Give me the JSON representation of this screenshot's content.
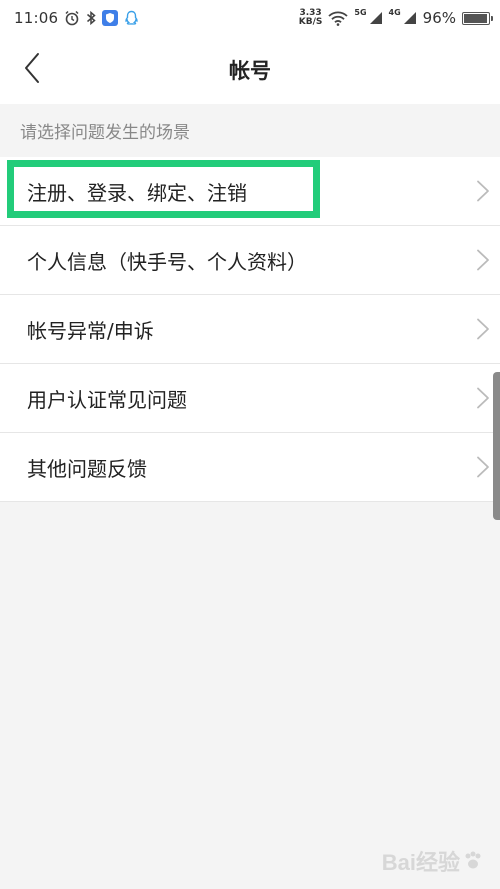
{
  "status_bar": {
    "time": "11:06",
    "net_speed_value": "3.33",
    "net_speed_unit": "KB/S",
    "signal_label_1": "5G",
    "signal_label_2": "4G",
    "battery_percent": "96%",
    "battery_level": 0.96,
    "icons": [
      "alarm-icon",
      "bluetooth-icon",
      "shield-app-icon",
      "qq-icon",
      "wifi-icon",
      "signal-icon",
      "battery-icon"
    ]
  },
  "nav": {
    "title": "帐号",
    "back_icon": "chevron-left-icon"
  },
  "section_hint": "请选择问题发生的场景",
  "menu": {
    "items": [
      {
        "label": "注册、登录、绑定、注销",
        "highlighted": true
      },
      {
        "label": "个人信息（快手号、个人资料）"
      },
      {
        "label": "帐号异常/申诉"
      },
      {
        "label": "用户认证常见问题"
      },
      {
        "label": "其他问题反馈"
      }
    ]
  },
  "watermark": {
    "text": "Bai经验"
  },
  "colors": {
    "highlight": "#22cc7a",
    "background": "#f4f4f4",
    "text_primary": "#222222",
    "text_secondary": "#888888"
  }
}
